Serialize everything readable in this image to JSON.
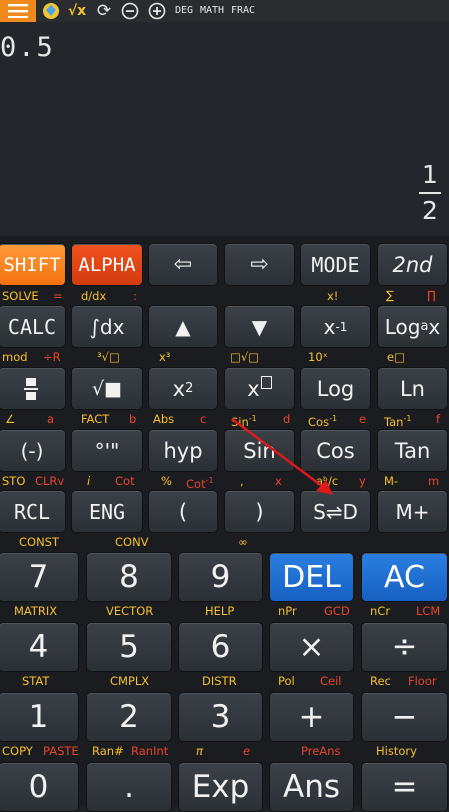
{
  "topbar": {
    "icons": [
      "menu-icon",
      "gem-icon",
      "sqrt-x-icon",
      "refresh-icon",
      "minus-circle-icon",
      "plus-circle-icon"
    ],
    "mode_labels": [
      "DEG",
      "MATH",
      "FRAC"
    ]
  },
  "display": {
    "input": "0.5",
    "result": {
      "numerator": "1",
      "denominator": "2"
    }
  },
  "rows": {
    "row1": [
      "SHIFT",
      "ALPHA",
      "⇦",
      "⇨",
      "MODE",
      "2nd"
    ],
    "row1_sub": {
      "solve": "SOLVE",
      "eq": "=",
      "ddx": "d/dx",
      ":": ":",
      "xfact": "x!",
      "sum": "∑",
      "prod": "∏"
    },
    "row2": {
      "calc": "CALC",
      "integral": "∫dx",
      "up": "▲",
      "down": "▼",
      "xinv": "x",
      "xinv_sup": "-1",
      "log": "Log",
      "log_sub": "a",
      "log_x": "x"
    },
    "row2_sub": {
      "mod": "mod",
      "divr": "÷R",
      "cbrt": "³√□",
      "x3": "x³",
      "xroot": "□√□",
      "ten_x": "10ˣ",
      "e_x": "e□"
    },
    "row3": {
      "sqrt": "√■",
      "x": "x",
      "x2_sup": "2",
      "xbox": "x",
      "log": "Log",
      "ln": "Ln"
    },
    "row3_sub": {
      "angle": "∠",
      "a": "a",
      "fact": "FACT",
      "b": "b",
      "abs": "Abs",
      "c": "c",
      "sin_inv": "Sin",
      "inv": "-1",
      "d": "d",
      "cos_inv": "Cos",
      "e": "e",
      "tan_inv": "Tan",
      "f": "f"
    },
    "row4": [
      "(-)",
      "°'\"",
      "hyp",
      "Sin",
      "Cos",
      "Tan"
    ],
    "row4_sub": {
      "sto": "STO",
      "clrv": "CLRv",
      "i": "i",
      "cot": "Cot",
      "pct": "%",
      "cot_inv": "Cot",
      "comma": ",",
      "x": "x",
      "abc": "aᵇ/c",
      "y": "y",
      "mminus": "M-",
      "m": "m"
    },
    "row5": [
      "RCL",
      "ENG",
      "(",
      ")",
      "S⇌D",
      "M+"
    ],
    "row5_sub": {
      "const": "CONST",
      "conv": "CONV",
      "inf": "∞"
    },
    "row6": [
      "7",
      "8",
      "9",
      "DEL",
      "AC"
    ],
    "row6_sub": {
      "matrix": "MATRIX",
      "vector": "VECTOR",
      "help": "HELP",
      "npr": "nPr",
      "gcd": "GCD",
      "ncr": "nCr",
      "lcm": "LCM"
    },
    "row7": [
      "4",
      "5",
      "6",
      "×",
      "÷"
    ],
    "row7_sub": {
      "stat": "STAT",
      "cmplx": "CMPLX",
      "distr": "DISTR",
      "pol": "Pol",
      "ceil": "Ceil",
      "rec": "Rec",
      "floor": "Floor"
    },
    "row8": [
      "1",
      "2",
      "3",
      "+",
      "−"
    ],
    "row8_sub": {
      "copy": "COPY",
      "paste": "PASTE",
      "ran": "Ran#",
      "ranint": "RanInt",
      "pi": "π",
      "e": "e",
      "preans": "PreAns",
      "history": "History"
    },
    "row9": [
      "0",
      ".",
      "Exp",
      "Ans",
      "="
    ]
  },
  "colors": {
    "shift": "#f2720f",
    "alpha": "#d23a10",
    "blue": "#1760c2",
    "yellow": "#f5c12e",
    "red": "#e8452b"
  }
}
